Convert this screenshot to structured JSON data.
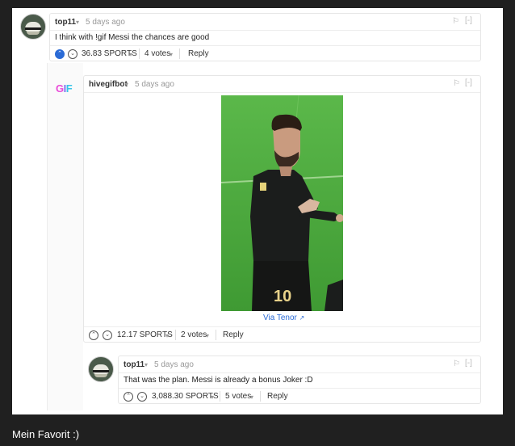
{
  "comments": [
    {
      "author": "top11",
      "time": "5 days ago",
      "text": "I think with !gif Messi the chances are good",
      "payout": "36.83 SPORTS",
      "votes": "4 votes",
      "reply": "Reply"
    },
    {
      "author": "hivegifbot",
      "time": "5 days ago",
      "avatar_text": [
        "G",
        "I",
        "F"
      ],
      "gif_link": "Via Tenor",
      "gif_jersey_number": "10",
      "payout": "12.17 SPORTS",
      "votes": "2 votes",
      "reply": "Reply"
    },
    {
      "author": "top11",
      "time": "5 days ago",
      "text": "That was the plan. Messi is already a bonus Joker :D",
      "payout": "3,088.30 SPORTS",
      "votes": "5 votes",
      "reply": "Reply"
    }
  ],
  "caption": "Mein Favorit :)",
  "icons": {
    "caret": "▾",
    "flag": "⚐",
    "collapse": "[-]",
    "upvote": "⌃",
    "downvote": "⌄",
    "external": "↗"
  },
  "colors": {
    "background": "#202020",
    "panel": "#ffffff",
    "link": "#2b6bd6",
    "upvoted": "#2b6bd6",
    "gif_field": "#49a93a"
  }
}
